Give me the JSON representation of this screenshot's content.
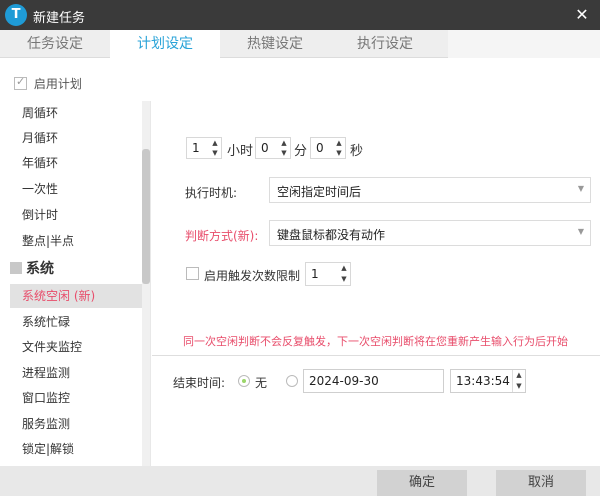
{
  "window": {
    "title": "新建任务",
    "logo_letter": "T"
  },
  "tabs": [
    {
      "label": "任务设定",
      "active": false
    },
    {
      "label": "计划设定",
      "active": true
    },
    {
      "label": "热键设定",
      "active": false
    },
    {
      "label": "执行设定",
      "active": false
    }
  ],
  "enable_plan": {
    "label": "启用计划",
    "checked": true
  },
  "sidebar": {
    "items_top": [
      "周循环",
      "月循环",
      "年循环",
      "一次性",
      "倒计时",
      "整点|半点"
    ],
    "group_label": "系统",
    "items_system": [
      "系统空闲 (新)",
      "系统忙碌",
      "文件夹监控",
      "进程监测",
      "窗口监控",
      "服务监测",
      "锁定|解锁"
    ],
    "active_item": "系统空闲 (新)"
  },
  "time_spinners": {
    "hours": "1",
    "hours_unit": "小时",
    "minutes": "0",
    "minutes_unit": "分",
    "seconds": "0",
    "seconds_unit": "秒"
  },
  "execute_timing": {
    "label": "执行时机:",
    "value": "空闲指定时间后"
  },
  "judge_mode": {
    "label": "判断方式(新):",
    "value": "键盘鼠标都没有动作"
  },
  "trigger_limit": {
    "label": "启用触发次数限制",
    "checked": false,
    "value": "1"
  },
  "notice": "同一次空闲判断不会反复触发，下一次空闲判断将在您重新产生输入行为后开始",
  "end_time": {
    "label": "结束时间:",
    "none_label": "无",
    "none_selected": true,
    "date": "2024-09-30",
    "time": "13:43:54"
  },
  "footer": {
    "ok_label": "确定",
    "cancel_label": "取消"
  },
  "colors": {
    "accent": "#29a3d8",
    "alert": "#e84d6b",
    "titlebar": "#3a3a3a"
  }
}
